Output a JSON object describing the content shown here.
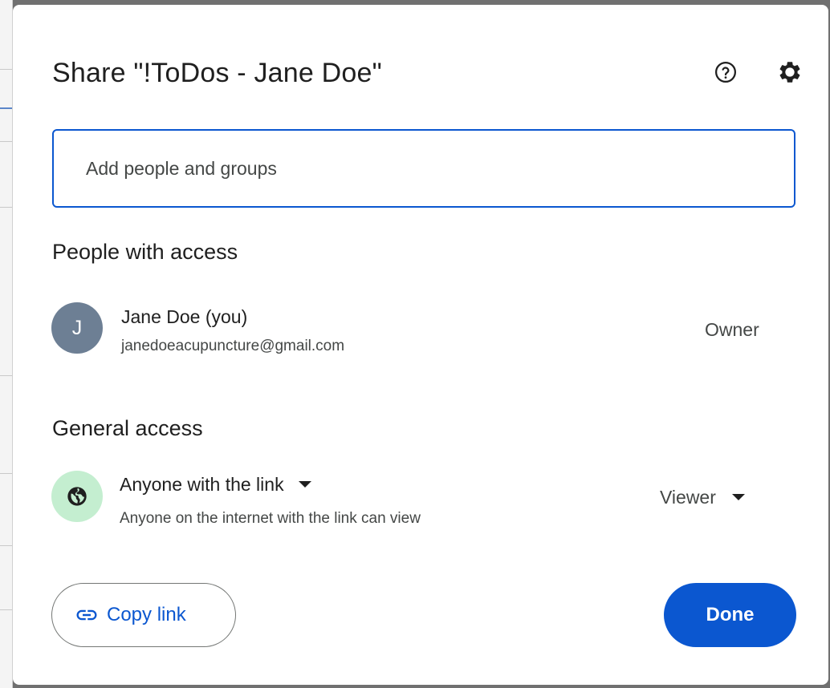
{
  "dialog": {
    "title": "Share \"!ToDos - Jane Doe\"",
    "icons": {
      "help": "help-circle-icon",
      "settings": "gear-icon"
    }
  },
  "search": {
    "placeholder": "Add people and groups"
  },
  "people_with_access": {
    "heading": "People with access",
    "people": [
      {
        "avatar_initial": "J",
        "name": "Jane Doe (you)",
        "email": "janedoeacupuncture@gmail.com",
        "role": "Owner"
      }
    ]
  },
  "general_access": {
    "heading": "General access",
    "icon": "globe-icon",
    "access_level": "Anyone with the link",
    "description": "Anyone on the internet with the link can view",
    "role": "Viewer"
  },
  "footer": {
    "copy_link_label": "Copy link",
    "copy_link_icon": "link-icon",
    "done_label": "Done"
  },
  "colors": {
    "accent": "#0b57d0",
    "avatar_bg": "#6d7f94",
    "globe_bg": "#c4eed0",
    "text_primary": "#1f1f1f",
    "text_secondary": "#444746"
  }
}
